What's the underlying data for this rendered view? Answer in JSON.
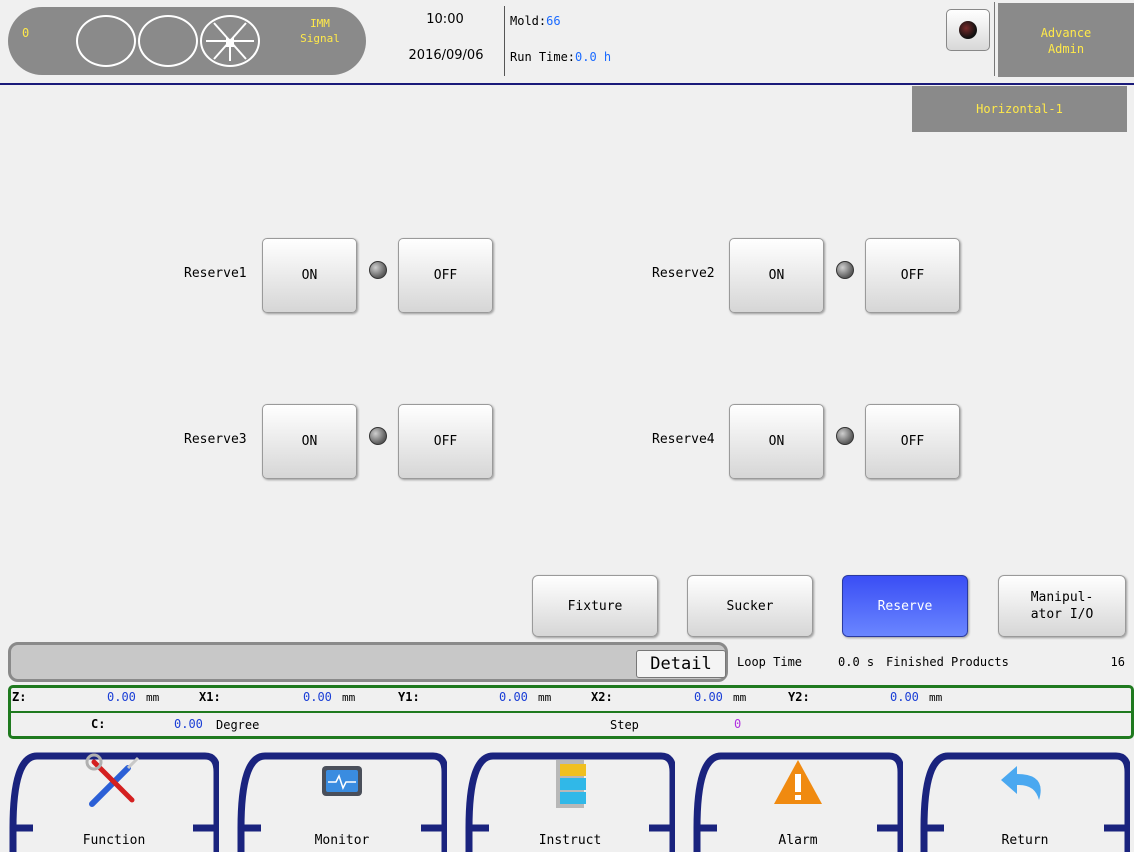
{
  "header": {
    "signal_count": "0",
    "signal_label_line1": "IMM",
    "signal_label_line2": "Signal",
    "time": "10:00",
    "date": "2016/09/06",
    "mold_label": "Mold:",
    "mold_value": "66",
    "runtime_label": "Run Time:",
    "runtime_value": "0.0 h",
    "user_line1": "Advance",
    "user_line2": "Admin"
  },
  "axis_name": "Horizontal-1",
  "reserves": [
    {
      "label": "Reserve1",
      "on": "ON",
      "off": "OFF"
    },
    {
      "label": "Reserve2",
      "on": "ON",
      "off": "OFF"
    },
    {
      "label": "Reserve3",
      "on": "ON",
      "off": "OFF"
    },
    {
      "label": "Reserve4",
      "on": "ON",
      "off": "OFF"
    }
  ],
  "tabs": {
    "fixture": "Fixture",
    "sucker": "Sucker",
    "reserve": "Reserve",
    "manip_line1": "Manipul-",
    "manip_line2": "ator I/O"
  },
  "status": {
    "detail": "Detail",
    "loop_label": "Loop Time",
    "loop_value": "0.0 s",
    "finished_label": "Finished Products",
    "finished_value": "16"
  },
  "axes": {
    "z_label": "Z:",
    "z_value": "0.00",
    "z_unit": "mm",
    "x1_label": "X1:",
    "x1_value": "0.00",
    "x1_unit": "mm",
    "y1_label": "Y1:",
    "y1_value": "0.00",
    "y1_unit": "mm",
    "x2_label": "X2:",
    "x2_value": "0.00",
    "x2_unit": "mm",
    "y2_label": "Y2:",
    "y2_value": "0.00",
    "y2_unit": "mm",
    "c_label": "C:",
    "c_value": "0.00",
    "c_unit": "Degree",
    "step_label": "Step",
    "step_value": "0"
  },
  "nav": {
    "function": "Function",
    "monitor": "Monitor",
    "instruct": "Instruct",
    "alarm": "Alarm",
    "return": "Return"
  },
  "colors": {
    "accent_blue": "#3a4ef5",
    "label_yellow": "#ffe94a",
    "panel_gray": "#8a8a8a",
    "axes_green": "#1f7a1f",
    "nav_frame": "#1a237e"
  },
  "icons": [
    "camera-icon",
    "wrench-screwdriver-icon",
    "monitor-icon",
    "file-cabinet-icon",
    "warning-icon",
    "return-arrow-icon"
  ]
}
